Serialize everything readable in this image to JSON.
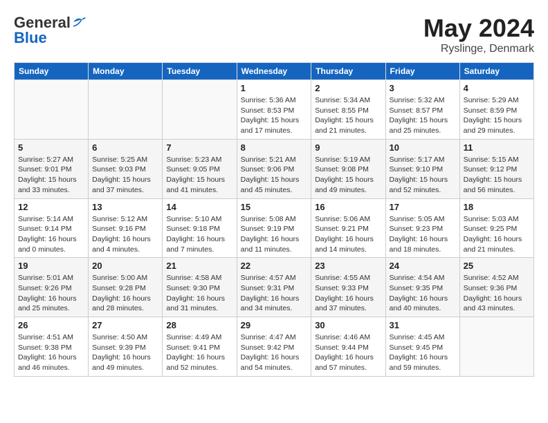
{
  "header": {
    "logo_general": "General",
    "logo_blue": "Blue",
    "month_year": "May 2024",
    "location": "Ryslinge, Denmark"
  },
  "days_of_week": [
    "Sunday",
    "Monday",
    "Tuesday",
    "Wednesday",
    "Thursday",
    "Friday",
    "Saturday"
  ],
  "weeks": [
    [
      {
        "day": "",
        "info": ""
      },
      {
        "day": "",
        "info": ""
      },
      {
        "day": "",
        "info": ""
      },
      {
        "day": "1",
        "info": "Sunrise: 5:36 AM\nSunset: 8:53 PM\nDaylight: 15 hours\nand 17 minutes."
      },
      {
        "day": "2",
        "info": "Sunrise: 5:34 AM\nSunset: 8:55 PM\nDaylight: 15 hours\nand 21 minutes."
      },
      {
        "day": "3",
        "info": "Sunrise: 5:32 AM\nSunset: 8:57 PM\nDaylight: 15 hours\nand 25 minutes."
      },
      {
        "day": "4",
        "info": "Sunrise: 5:29 AM\nSunset: 8:59 PM\nDaylight: 15 hours\nand 29 minutes."
      }
    ],
    [
      {
        "day": "5",
        "info": "Sunrise: 5:27 AM\nSunset: 9:01 PM\nDaylight: 15 hours\nand 33 minutes."
      },
      {
        "day": "6",
        "info": "Sunrise: 5:25 AM\nSunset: 9:03 PM\nDaylight: 15 hours\nand 37 minutes."
      },
      {
        "day": "7",
        "info": "Sunrise: 5:23 AM\nSunset: 9:05 PM\nDaylight: 15 hours\nand 41 minutes."
      },
      {
        "day": "8",
        "info": "Sunrise: 5:21 AM\nSunset: 9:06 PM\nDaylight: 15 hours\nand 45 minutes."
      },
      {
        "day": "9",
        "info": "Sunrise: 5:19 AM\nSunset: 9:08 PM\nDaylight: 15 hours\nand 49 minutes."
      },
      {
        "day": "10",
        "info": "Sunrise: 5:17 AM\nSunset: 9:10 PM\nDaylight: 15 hours\nand 52 minutes."
      },
      {
        "day": "11",
        "info": "Sunrise: 5:15 AM\nSunset: 9:12 PM\nDaylight: 15 hours\nand 56 minutes."
      }
    ],
    [
      {
        "day": "12",
        "info": "Sunrise: 5:14 AM\nSunset: 9:14 PM\nDaylight: 16 hours\nand 0 minutes."
      },
      {
        "day": "13",
        "info": "Sunrise: 5:12 AM\nSunset: 9:16 PM\nDaylight: 16 hours\nand 4 minutes."
      },
      {
        "day": "14",
        "info": "Sunrise: 5:10 AM\nSunset: 9:18 PM\nDaylight: 16 hours\nand 7 minutes."
      },
      {
        "day": "15",
        "info": "Sunrise: 5:08 AM\nSunset: 9:19 PM\nDaylight: 16 hours\nand 11 minutes."
      },
      {
        "day": "16",
        "info": "Sunrise: 5:06 AM\nSunset: 9:21 PM\nDaylight: 16 hours\nand 14 minutes."
      },
      {
        "day": "17",
        "info": "Sunrise: 5:05 AM\nSunset: 9:23 PM\nDaylight: 16 hours\nand 18 minutes."
      },
      {
        "day": "18",
        "info": "Sunrise: 5:03 AM\nSunset: 9:25 PM\nDaylight: 16 hours\nand 21 minutes."
      }
    ],
    [
      {
        "day": "19",
        "info": "Sunrise: 5:01 AM\nSunset: 9:26 PM\nDaylight: 16 hours\nand 25 minutes."
      },
      {
        "day": "20",
        "info": "Sunrise: 5:00 AM\nSunset: 9:28 PM\nDaylight: 16 hours\nand 28 minutes."
      },
      {
        "day": "21",
        "info": "Sunrise: 4:58 AM\nSunset: 9:30 PM\nDaylight: 16 hours\nand 31 minutes."
      },
      {
        "day": "22",
        "info": "Sunrise: 4:57 AM\nSunset: 9:31 PM\nDaylight: 16 hours\nand 34 minutes."
      },
      {
        "day": "23",
        "info": "Sunrise: 4:55 AM\nSunset: 9:33 PM\nDaylight: 16 hours\nand 37 minutes."
      },
      {
        "day": "24",
        "info": "Sunrise: 4:54 AM\nSunset: 9:35 PM\nDaylight: 16 hours\nand 40 minutes."
      },
      {
        "day": "25",
        "info": "Sunrise: 4:52 AM\nSunset: 9:36 PM\nDaylight: 16 hours\nand 43 minutes."
      }
    ],
    [
      {
        "day": "26",
        "info": "Sunrise: 4:51 AM\nSunset: 9:38 PM\nDaylight: 16 hours\nand 46 minutes."
      },
      {
        "day": "27",
        "info": "Sunrise: 4:50 AM\nSunset: 9:39 PM\nDaylight: 16 hours\nand 49 minutes."
      },
      {
        "day": "28",
        "info": "Sunrise: 4:49 AM\nSunset: 9:41 PM\nDaylight: 16 hours\nand 52 minutes."
      },
      {
        "day": "29",
        "info": "Sunrise: 4:47 AM\nSunset: 9:42 PM\nDaylight: 16 hours\nand 54 minutes."
      },
      {
        "day": "30",
        "info": "Sunrise: 4:46 AM\nSunset: 9:44 PM\nDaylight: 16 hours\nand 57 minutes."
      },
      {
        "day": "31",
        "info": "Sunrise: 4:45 AM\nSunset: 9:45 PM\nDaylight: 16 hours\nand 59 minutes."
      },
      {
        "day": "",
        "info": ""
      }
    ]
  ]
}
